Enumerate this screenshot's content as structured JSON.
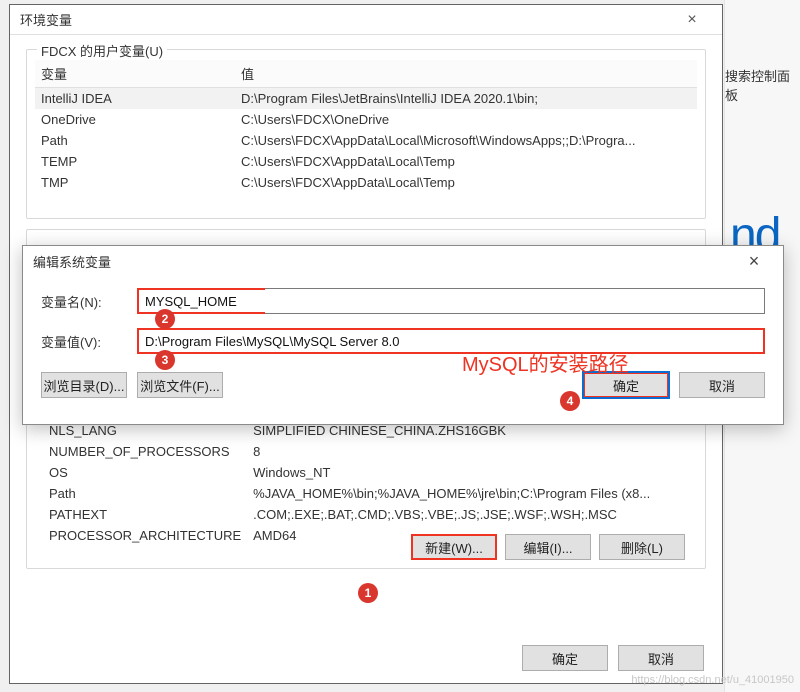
{
  "env_dialog": {
    "title": "环境变量",
    "close": "×",
    "user_vars_title": "FDCX 的用户变量(U)",
    "col_var": "变量",
    "col_val": "值",
    "user_vars": [
      {
        "name": "IntelliJ IDEA",
        "value": "D:\\Program Files\\JetBrains\\IntelliJ IDEA 2020.1\\bin;"
      },
      {
        "name": "OneDrive",
        "value": "C:\\Users\\FDCX\\OneDrive"
      },
      {
        "name": "Path",
        "value": "C:\\Users\\FDCX\\AppData\\Local\\Microsoft\\WindowsApps;;D:\\Progra..."
      },
      {
        "name": "TEMP",
        "value": "C:\\Users\\FDCX\\AppData\\Local\\Temp"
      },
      {
        "name": "TMP",
        "value": "C:\\Users\\FDCX\\AppData\\Local\\Temp"
      }
    ],
    "sys_vars": [
      {
        "name": "NLS_LANG",
        "value": "SIMPLIFIED CHINESE_CHINA.ZHS16GBK"
      },
      {
        "name": "NUMBER_OF_PROCESSORS",
        "value": "8"
      },
      {
        "name": "OS",
        "value": "Windows_NT"
      },
      {
        "name": "Path",
        "value": "%JAVA_HOME%\\bin;%JAVA_HOME%\\jre\\bin;C:\\Program Files (x8..."
      },
      {
        "name": "PATHEXT",
        "value": ".COM;.EXE;.BAT;.CMD;.VBS;.VBE;.JS;.JSE;.WSF;.WSH;.MSC"
      },
      {
        "name": "PROCESSOR_ARCHITECTURE",
        "value": "AMD64"
      }
    ],
    "buttons": {
      "new": "新建(W)...",
      "edit": "编辑(I)...",
      "delete": "删除(L)",
      "ok": "确定",
      "cancel": "取消"
    }
  },
  "edit_dialog": {
    "title": "编辑系统变量",
    "close": "×",
    "name_label": "变量名(N):",
    "name_value": "MYSQL_HOME",
    "value_label": "变量值(V):",
    "value_value": "D:\\Program Files\\MySQL\\MySQL Server 8.0",
    "browse_dir": "浏览目录(D)...",
    "browse_file": "浏览文件(F)...",
    "ok": "确定",
    "cancel": "取消"
  },
  "annotations": {
    "c1": "1",
    "c2": "2",
    "c3": "3",
    "c4": "4",
    "text": "MySQL的安装路径"
  },
  "bg": {
    "search": "搜索控制面板",
    "nd": "nd"
  },
  "watermark": "https://blog.csdn.net/u_41001950"
}
